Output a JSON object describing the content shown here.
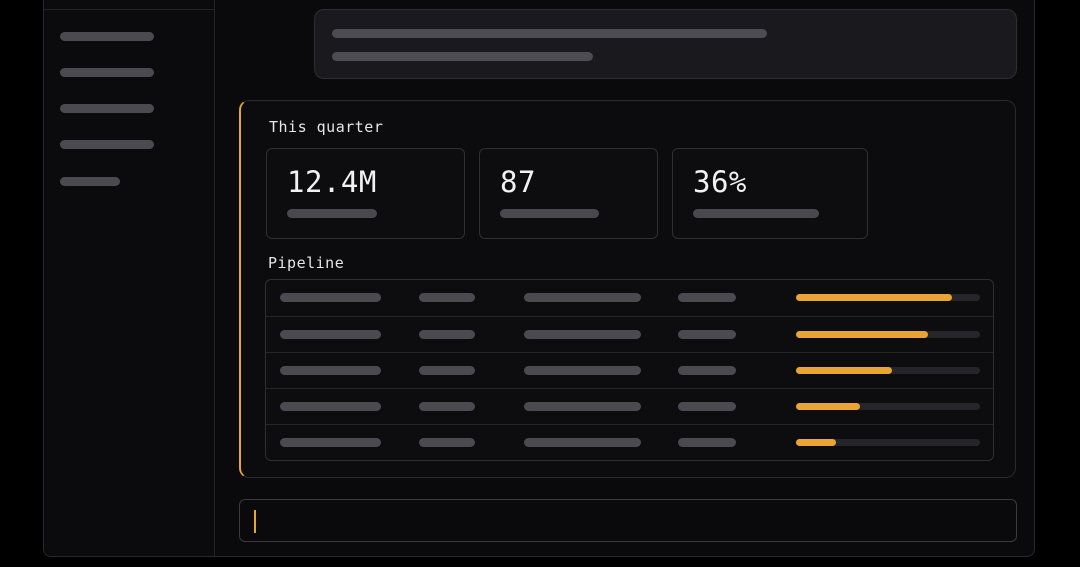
{
  "colors": {
    "accent": "#e8a534",
    "background": "#0a0a0c",
    "placeholder_bar": "#4a4a50"
  },
  "summary": {
    "title": "This quarter",
    "stats": [
      {
        "value": "12.4M"
      },
      {
        "value": "87"
      },
      {
        "value": "36%"
      }
    ]
  },
  "pipeline": {
    "title": "Pipeline",
    "rows": [
      {
        "progress": 0.85
      },
      {
        "progress": 0.72
      },
      {
        "progress": 0.52
      },
      {
        "progress": 0.35
      },
      {
        "progress": 0.22
      }
    ]
  },
  "composer": {
    "value": ""
  }
}
